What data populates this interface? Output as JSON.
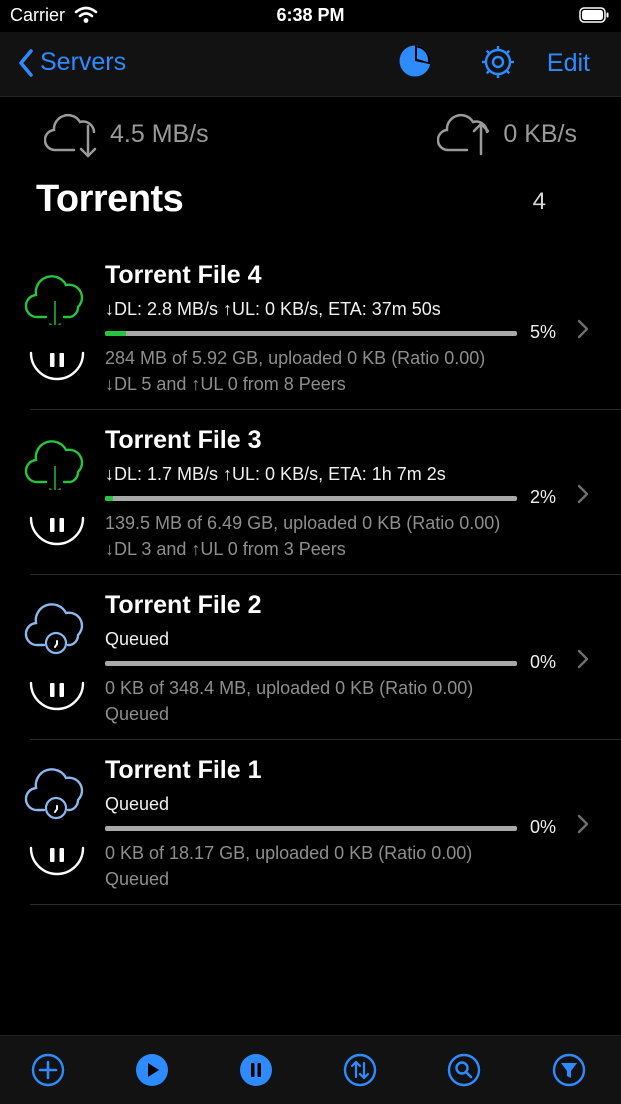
{
  "status_bar": {
    "carrier": "Carrier",
    "time": "6:38 PM"
  },
  "nav": {
    "back_label": "Servers",
    "edit_label": "Edit",
    "icons": [
      "chart-pie-icon",
      "settings-gear-icon"
    ],
    "accent_color": "#2e8bff"
  },
  "speeds": {
    "download": "4.5 MB/s",
    "upload": "0 KB/s"
  },
  "section": {
    "title": "Torrents",
    "count": "4"
  },
  "torrents": [
    {
      "name": "Torrent File 4",
      "status": "downloading",
      "line1": "↓DL: 2.8 MB/s ↑UL: 0 KB/s, ETA: 37m 50s",
      "percent": "5%",
      "progress": 0.05,
      "line2": "284 MB of 5.92 GB, uploaded 0 KB (Ratio 0.00)",
      "line3": "↓DL 5 and ↑UL 0 from 8 Peers"
    },
    {
      "name": "Torrent File 3",
      "status": "downloading",
      "line1": "↓DL: 1.7 MB/s ↑UL: 0 KB/s, ETA: 1h 7m 2s",
      "percent": "2%",
      "progress": 0.02,
      "line2": "139.5 MB of 6.49 GB, uploaded 0 KB (Ratio 0.00)",
      "line3": "↓DL 3 and ↑UL 0 from 3 Peers"
    },
    {
      "name": "Torrent File 2",
      "status": "queued",
      "line1": "Queued",
      "percent": "0%",
      "progress": 0,
      "line2": "0 KB of 348.4 MB, uploaded 0 KB (Ratio 0.00)",
      "line3": "Queued"
    },
    {
      "name": "Torrent File 1",
      "status": "queued",
      "line1": "Queued",
      "percent": "0%",
      "progress": 0,
      "line2": "0 KB of 18.17 GB, uploaded 0 KB (Ratio 0.00)",
      "line3": "Queued"
    }
  ],
  "toolbar": {
    "icons": [
      "add-icon",
      "play-all-icon",
      "pause-all-icon",
      "transfer-icon",
      "search-icon",
      "filter-icon"
    ]
  },
  "colors": {
    "download_green": "#27c43f",
    "queued_blue": "#8cb8ee",
    "accent": "#2e8bff"
  }
}
